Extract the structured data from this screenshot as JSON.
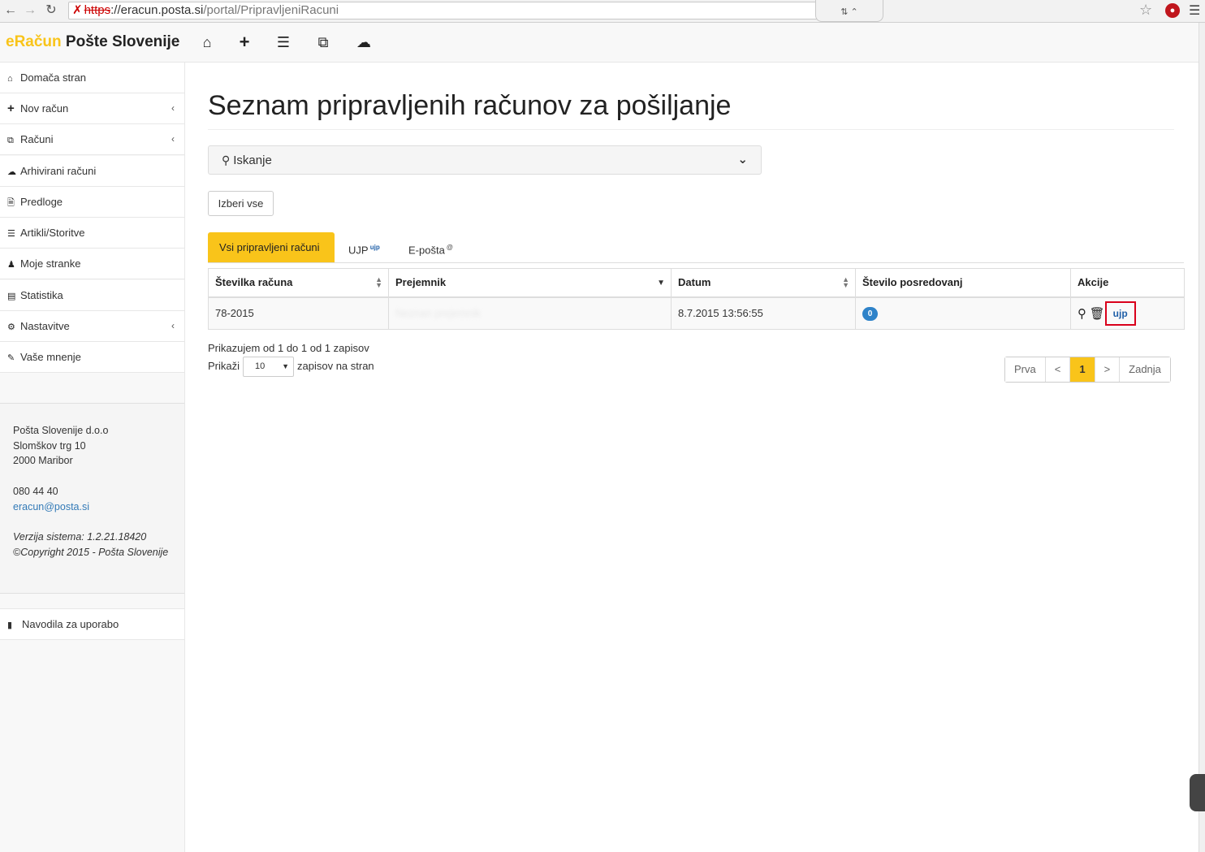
{
  "browser": {
    "url_scheme": "https",
    "url_host": "://eracun.posta.si",
    "url_path": "/portal/PripravljeniRacuni"
  },
  "header": {
    "brand_accent": "eRačun",
    "brand_rest": "Pošte Slovenije"
  },
  "sidebar": {
    "items": [
      {
        "label": "Domača stran"
      },
      {
        "label": "Nov račun"
      },
      {
        "label": "Računi"
      },
      {
        "label": "Arhivirani računi"
      },
      {
        "label": "Predloge"
      },
      {
        "label": "Artikli/Storitve"
      },
      {
        "label": "Moje stranke"
      },
      {
        "label": "Statistika"
      },
      {
        "label": "Nastavitve"
      },
      {
        "label": "Vaše mnenje"
      }
    ],
    "footer": {
      "company": "Pošta Slovenije d.o.o",
      "street": "Slomškov trg 10",
      "city": "2000 Maribor",
      "phone": "080 44 40",
      "email": "eracun@posta.si",
      "version": "Verzija sistema: 1.2.21.18420",
      "copyright": "©Copyright 2015 - Pošta Slovenije"
    },
    "help": "Navodila za uporabo"
  },
  "main": {
    "title": "Seznam pripravljenih računov za pošiljanje",
    "search_label": "Iskanje",
    "select_all": "Izberi vse",
    "tabs": [
      {
        "label": "Vsi pripravljeni računi"
      },
      {
        "label": "UJP"
      },
      {
        "label": "E-pošta"
      }
    ],
    "table": {
      "headers": [
        "Številka računa",
        "Prejemnik",
        "Datum",
        "Število posredovanj",
        "Akcije"
      ],
      "rows": [
        {
          "number": "78-2015",
          "recipient": "Neznan prejemnik",
          "date": "8.7.2015 13:56:55",
          "forwards": "0",
          "ujp": "ujp"
        }
      ]
    },
    "showing": "Prikazujem od 1 do 1 od 1 zapisov",
    "show_label": "Prikaži",
    "page_size": "10",
    "per_page_label": "zapisov na stran",
    "pager": {
      "first": "Prva",
      "prev": "<",
      "current": "1",
      "next": ">",
      "last": "Zadnja"
    }
  }
}
